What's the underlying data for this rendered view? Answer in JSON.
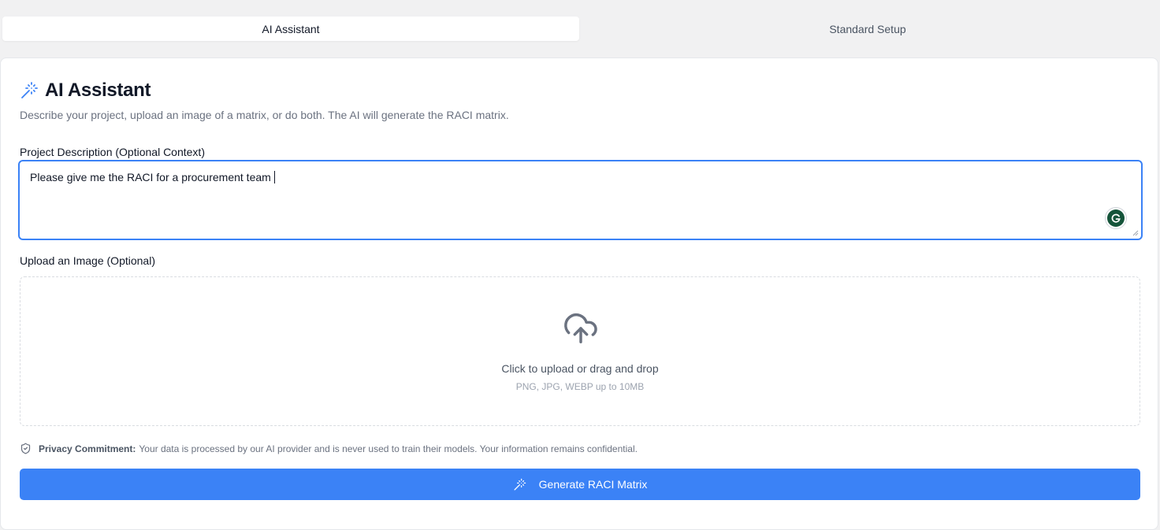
{
  "tabs": [
    {
      "label": "AI Assistant",
      "active": true
    },
    {
      "label": "Standard Setup",
      "active": false
    }
  ],
  "card": {
    "title": "AI Assistant",
    "title_icon": "magic-wand-icon",
    "subtitle": "Describe your project, upload an image of a matrix, or do both. The AI will generate the RACI matrix."
  },
  "description": {
    "label": "Project Description (Optional Context)",
    "value": "Please give me the RACI for a procurement team",
    "extension_icon": "grammarly-icon"
  },
  "upload": {
    "label": "Upload an Image (Optional)",
    "icon": "cloud-upload-icon",
    "main_text": "Click to upload or drag and drop",
    "sub_text": "PNG, JPG, WEBP up to 10MB"
  },
  "privacy": {
    "icon": "shield-check-icon",
    "title": "Privacy Commitment:",
    "text": "Your data is processed by our AI provider and is never used to train their models. Your information remains confidential."
  },
  "generate_button": {
    "label": "Generate RACI Matrix",
    "icon": "magic-wand-icon"
  },
  "colors": {
    "accent": "#3b82f6",
    "background": "#f1f1f2",
    "card": "#ffffff"
  }
}
